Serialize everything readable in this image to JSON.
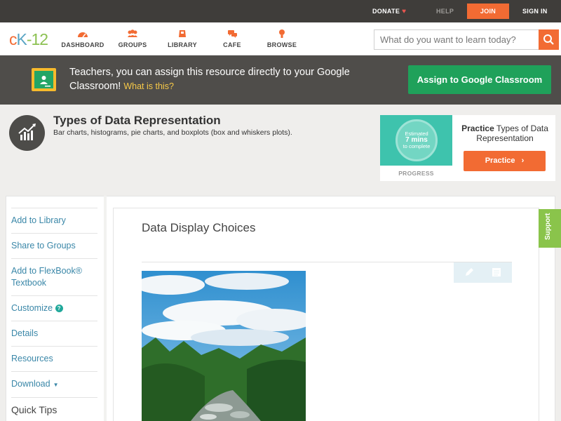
{
  "topbar": {
    "donate": "DONATE",
    "help": "HELP",
    "join": "JOIN",
    "sign_in": "SIGN IN"
  },
  "nav": {
    "logo": {
      "c": "c",
      "k": "K",
      "dash": "-",
      "n": "12"
    },
    "items": [
      {
        "label": "DASHBOARD",
        "icon": "dashboard-icon"
      },
      {
        "label": "GROUPS",
        "icon": "groups-icon"
      },
      {
        "label": "LIBRARY",
        "icon": "library-icon"
      },
      {
        "label": "CAFE",
        "icon": "cafe-icon"
      },
      {
        "label": "BROWSE",
        "icon": "browse-icon"
      }
    ],
    "search_placeholder": "What do you want to learn today?"
  },
  "classroom_banner": {
    "text": "Teachers, you can assign this resource directly to your Google Classroom!",
    "what_link": "What is this?",
    "button": "Assign to Google Classroom"
  },
  "topic": {
    "title": "Types of Data Representation",
    "description": "Bar charts, histograms, pie charts, and boxplots (box and whiskers plots)."
  },
  "practice": {
    "estimated_line1": "Estimated",
    "estimated_line2": "7 mins",
    "estimated_line3": "to complete",
    "progress_label": "PROGRESS",
    "title_bold": "Practice",
    "title_rest": "Types of Data Representation",
    "button": "Practice"
  },
  "sidebar": {
    "items": [
      {
        "label": "Add to Library"
      },
      {
        "label": "Share to Groups"
      },
      {
        "label": "Add to FlexBook® Textbook"
      },
      {
        "label": "Customize"
      },
      {
        "label": "Details"
      },
      {
        "label": "Resources"
      },
      {
        "label": "Download"
      }
    ],
    "quick_tips": "Quick Tips"
  },
  "content": {
    "title": "Data Display Choices"
  },
  "support": "Support",
  "colors": {
    "brand_orange": "#f26b33",
    "classroom_green": "#1fa15a",
    "link_blue": "#3a87a8",
    "support_green": "#8ac44b"
  }
}
